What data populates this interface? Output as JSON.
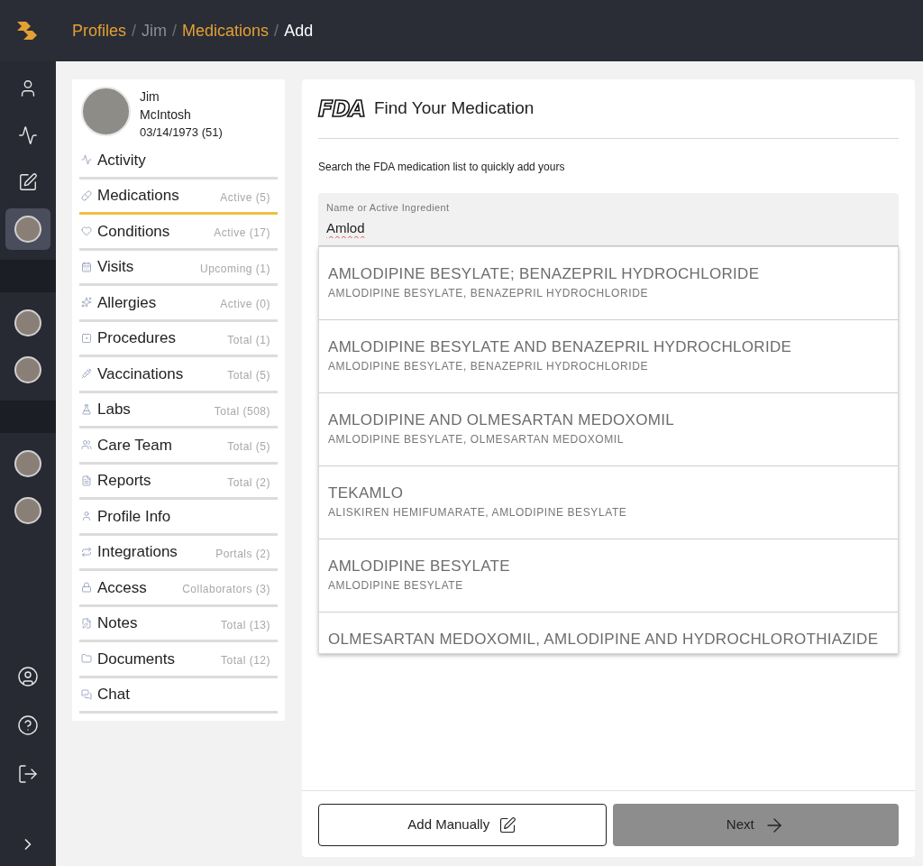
{
  "breadcrumb": [
    {
      "label": "Profiles",
      "kind": "link"
    },
    {
      "label": "/",
      "kind": "separator"
    },
    {
      "label": "Jim",
      "kind": "muted"
    },
    {
      "label": "/",
      "kind": "separator"
    },
    {
      "label": "Medications",
      "kind": "link"
    },
    {
      "label": "/",
      "kind": "separator"
    },
    {
      "label": "Add",
      "kind": "current"
    }
  ],
  "rail": {
    "items": [
      {
        "kind": "icon",
        "selected": false
      },
      {
        "kind": "icon",
        "selected": false
      },
      {
        "kind": "icon",
        "selected": false
      },
      {
        "kind": "avatar",
        "selected": true
      },
      {
        "kind": "band"
      },
      {
        "kind": "avatar",
        "selected": false
      },
      {
        "kind": "avatar",
        "selected": false
      },
      {
        "kind": "band"
      },
      {
        "kind": "avatar",
        "selected": false
      },
      {
        "kind": "avatar",
        "selected": false
      }
    ]
  },
  "profile": {
    "first_name": "Jim",
    "last_name": "McIntosh",
    "dob": "03/14/1973 (51)"
  },
  "nav": [
    {
      "label": "Activity",
      "selected": false
    },
    {
      "label": "Medications",
      "count": "Active (5)",
      "selected": true
    },
    {
      "label": "Conditions",
      "count": "Active (17)",
      "selected": false
    },
    {
      "label": "Visits",
      "count": "Upcoming (1)",
      "selected": false
    },
    {
      "label": "Allergies",
      "count": "Active (0)",
      "selected": false
    },
    {
      "label": "Procedures",
      "count": "Total (1)",
      "selected": false
    },
    {
      "label": "Vaccinations",
      "count": "Total (5)",
      "selected": false
    },
    {
      "label": "Labs",
      "count": "Total (508)",
      "selected": false
    },
    {
      "label": "Care Team",
      "count": "Total (5)",
      "selected": false
    },
    {
      "label": "Reports",
      "count": "Total (2)",
      "selected": false
    },
    {
      "label": "Profile Info",
      "selected": false
    },
    {
      "label": "Integrations",
      "count": "Portals (2)",
      "selected": false
    },
    {
      "label": "Access",
      "count": "Collaborators (3)",
      "selected": false
    },
    {
      "label": "Notes",
      "count": "Total (13)",
      "selected": false
    },
    {
      "label": "Documents",
      "count": "Total (12)",
      "selected": false
    },
    {
      "label": "Chat",
      "selected": false
    }
  ],
  "panel": {
    "logo": "FDA",
    "title": "Find Your Medication",
    "description": "Search the FDA medication list to quickly add yours",
    "search": {
      "label": "Name or Active Ingredient",
      "value": "Amlod"
    },
    "results": [
      {
        "name": "AMLODIPINE BESYLATE; BENAZEPRIL HYDROCHLORIDE",
        "ingredients": "AMLODIPINE BESYLATE, BENAZEPRIL HYDROCHLORIDE"
      },
      {
        "name": "AMLODIPINE BESYLATE AND BENAZEPRIL HYDROCHLORIDE",
        "ingredients": "AMLODIPINE BESYLATE, BENAZEPRIL HYDROCHLORIDE"
      },
      {
        "name": "AMLODIPINE AND OLMESARTAN MEDOXOMIL",
        "ingredients": "AMLODIPINE BESYLATE, OLMESARTAN MEDOXOMIL"
      },
      {
        "name": "TEKAMLO",
        "ingredients": "ALISKIREN HEMIFUMARATE, AMLODIPINE BESYLATE"
      },
      {
        "name": "AMLODIPINE BESYLATE",
        "ingredients": "AMLODIPINE BESYLATE"
      },
      {
        "name": "OLMESARTAN MEDOXOMIL, AMLODIPINE AND HYDROCHLOROTHIAZIDE"
      }
    ],
    "buttons": [
      {
        "label": "Add Manually",
        "kind": "outline"
      },
      {
        "label": "Next",
        "kind": "filled"
      }
    ]
  }
}
